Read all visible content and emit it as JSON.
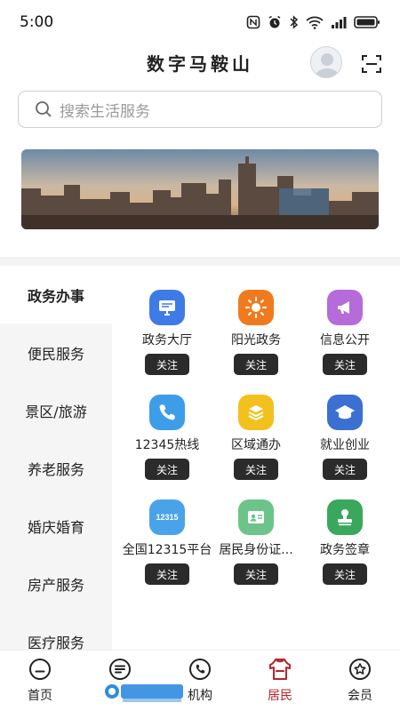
{
  "status_bar": {
    "time": "5:00"
  },
  "header": {
    "title": "数字马鞍山"
  },
  "search": {
    "placeholder": "搜索生活服务"
  },
  "categories": [
    {
      "label": "政务办事",
      "active": true
    },
    {
      "label": "便民服务"
    },
    {
      "label": "景区/旅游"
    },
    {
      "label": "养老服务"
    },
    {
      "label": "婚庆婚育"
    },
    {
      "label": "房产服务"
    },
    {
      "label": "医疗服务"
    }
  ],
  "services": [
    {
      "label": "政务大厅",
      "icon": "monitor-icon",
      "color": "#3f7be6",
      "follow": "关注"
    },
    {
      "label": "阳光政务",
      "icon": "sun-icon",
      "color": "#f07b1e",
      "follow": "关注"
    },
    {
      "label": "信息公开",
      "icon": "megaphone-icon",
      "color": "#b56bd9",
      "follow": "关注"
    },
    {
      "label": "12345热线",
      "icon": "phone-icon",
      "color": "#3d9de8",
      "follow": "关注"
    },
    {
      "label": "区域通办",
      "icon": "layers-icon",
      "color": "#f2c11e",
      "follow": "关注"
    },
    {
      "label": "就业创业",
      "icon": "graduation-cap-icon",
      "color": "#3b6fd1",
      "follow": "关注"
    },
    {
      "label": "全国12315平台",
      "icon": "badge-12315-icon",
      "icon_text": "12315",
      "color": "#4aa3e8",
      "follow": "关注"
    },
    {
      "label": "居民身份证...",
      "icon": "id-card-icon",
      "color": "#6cc48a",
      "follow": "关注"
    },
    {
      "label": "政务签章",
      "icon": "seal-icon",
      "color": "#3aa85c",
      "follow": "关注"
    }
  ],
  "bottom_nav": [
    {
      "label": "首页",
      "icon": "home-icon"
    },
    {
      "label": "",
      "icon": "list-icon"
    },
    {
      "label": "机构",
      "icon": "phone-circle-icon"
    },
    {
      "label": "居民",
      "icon": "resident-icon",
      "active": true
    },
    {
      "label": "会员",
      "icon": "member-star-icon"
    }
  ],
  "colors": {
    "accent": "#b3262c",
    "follow_button": "#2b2b2b"
  }
}
